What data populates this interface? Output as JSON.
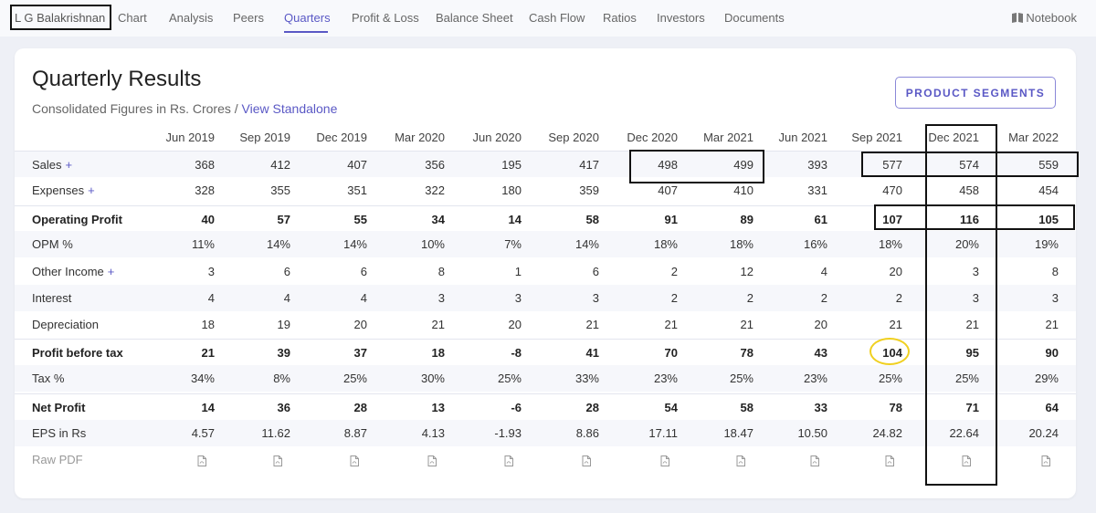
{
  "nav": {
    "company": "L G Balakrishnan",
    "items": [
      "Chart",
      "Analysis",
      "Peers",
      "Quarters",
      "Profit & Loss",
      "Balance Sheet",
      "Cash Flow",
      "Ratios",
      "Investors",
      "Documents"
    ],
    "active": "Quarters",
    "notebook": "Notebook"
  },
  "section": {
    "title": "Quarterly Results",
    "subtitle": "Consolidated Figures in Rs. Crores / ",
    "subtitle_link": "View Standalone",
    "segments_button": "PRODUCT SEGMENTS"
  },
  "table": {
    "columns": [
      "Jun 2019",
      "Sep 2019",
      "Dec 2019",
      "Mar 2020",
      "Jun 2020",
      "Sep 2020",
      "Dec 2020",
      "Mar 2021",
      "Jun 2021",
      "Sep 2021",
      "Dec 2021",
      "Mar 2022"
    ],
    "rows": [
      {
        "label": "Sales",
        "plus": "+",
        "values": [
          "368",
          "412",
          "407",
          "356",
          "195",
          "417",
          "498",
          "499",
          "393",
          "577",
          "574",
          "559"
        ]
      },
      {
        "label": "Expenses",
        "plus": "+",
        "values": [
          "328",
          "355",
          "351",
          "322",
          "180",
          "359",
          "407",
          "410",
          "331",
          "470",
          "458",
          "454"
        ]
      },
      {
        "label": "Operating Profit",
        "values": [
          "40",
          "57",
          "55",
          "34",
          "14",
          "58",
          "91",
          "89",
          "61",
          "107",
          "116",
          "105"
        ]
      },
      {
        "label": "OPM %",
        "values": [
          "11%",
          "14%",
          "14%",
          "10%",
          "7%",
          "14%",
          "18%",
          "18%",
          "16%",
          "18%",
          "20%",
          "19%"
        ]
      },
      {
        "label": "Other Income",
        "plus": "+",
        "values": [
          "3",
          "6",
          "6",
          "8",
          "1",
          "6",
          "2",
          "12",
          "4",
          "20",
          "3",
          "8"
        ]
      },
      {
        "label": "Interest",
        "values": [
          "4",
          "4",
          "4",
          "3",
          "3",
          "3",
          "2",
          "2",
          "2",
          "2",
          "3",
          "3"
        ]
      },
      {
        "label": "Depreciation",
        "values": [
          "18",
          "19",
          "20",
          "21",
          "20",
          "21",
          "21",
          "21",
          "20",
          "21",
          "21",
          "21"
        ]
      },
      {
        "label": "Profit before tax",
        "values": [
          "21",
          "39",
          "37",
          "18",
          "-8",
          "41",
          "70",
          "78",
          "43",
          "104",
          "95",
          "90"
        ]
      },
      {
        "label": "Tax %",
        "values": [
          "34%",
          "8%",
          "25%",
          "30%",
          "25%",
          "33%",
          "23%",
          "25%",
          "23%",
          "25%",
          "25%",
          "29%"
        ]
      },
      {
        "label": "Net Profit",
        "values": [
          "14",
          "36",
          "28",
          "13",
          "-6",
          "28",
          "54",
          "58",
          "33",
          "78",
          "71",
          "64"
        ]
      },
      {
        "label": "EPS in Rs",
        "values": [
          "4.57",
          "11.62",
          "8.87",
          "4.13",
          "-1.93",
          "8.86",
          "17.11",
          "18.47",
          "10.50",
          "24.82",
          "22.64",
          "20.24"
        ]
      },
      {
        "label": "Raw PDF",
        "values": []
      }
    ]
  },
  "colors": {
    "accent": "#5a58c5",
    "highlight_circle": "#f0d020",
    "annotation_box": "#111111"
  }
}
